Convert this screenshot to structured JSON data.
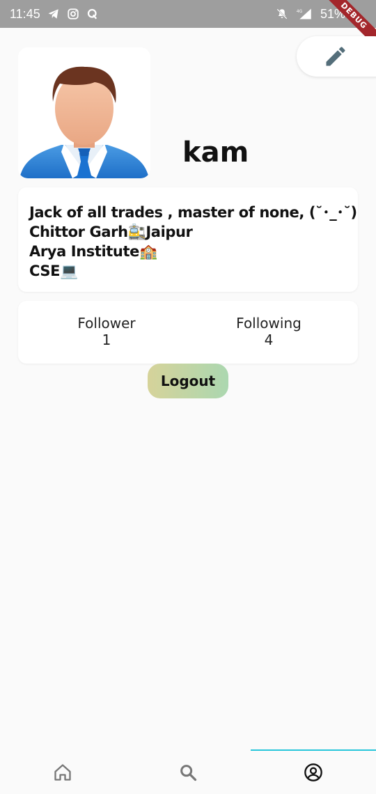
{
  "status_bar": {
    "time": "11:45",
    "battery": "51%",
    "network": "4G",
    "icons_left": [
      "telegram-icon",
      "instagram-icon",
      "q-icon"
    ],
    "icons_right": [
      "mute-icon",
      "signal-icon",
      "battery-icon"
    ]
  },
  "debug_banner": "DEBUG",
  "profile": {
    "username": "kam",
    "bio_lines": [
      "Jack of all trades , master of none, (˘･_･˘)",
      "Chittor Garh🚉Jaipur",
      "Arya Institute🏫",
      "CSE💻"
    ]
  },
  "stats": {
    "follower_label": "Follower",
    "follower_count": "1",
    "following_label": "Following",
    "following_count": "4"
  },
  "actions": {
    "logout_label": "Logout",
    "edit_icon": "pencil-icon"
  },
  "bottom_nav": {
    "items": [
      "home-icon",
      "search-icon",
      "profile-icon"
    ],
    "active": "profile",
    "accent": "#26c6da"
  },
  "colors": {
    "background": "#fafafa",
    "status_bar": "#9e9e9e",
    "logout_gradient_start": "#d6d39a",
    "logout_gradient_end": "#abd7b0",
    "edit_icon": "#546e7a"
  }
}
